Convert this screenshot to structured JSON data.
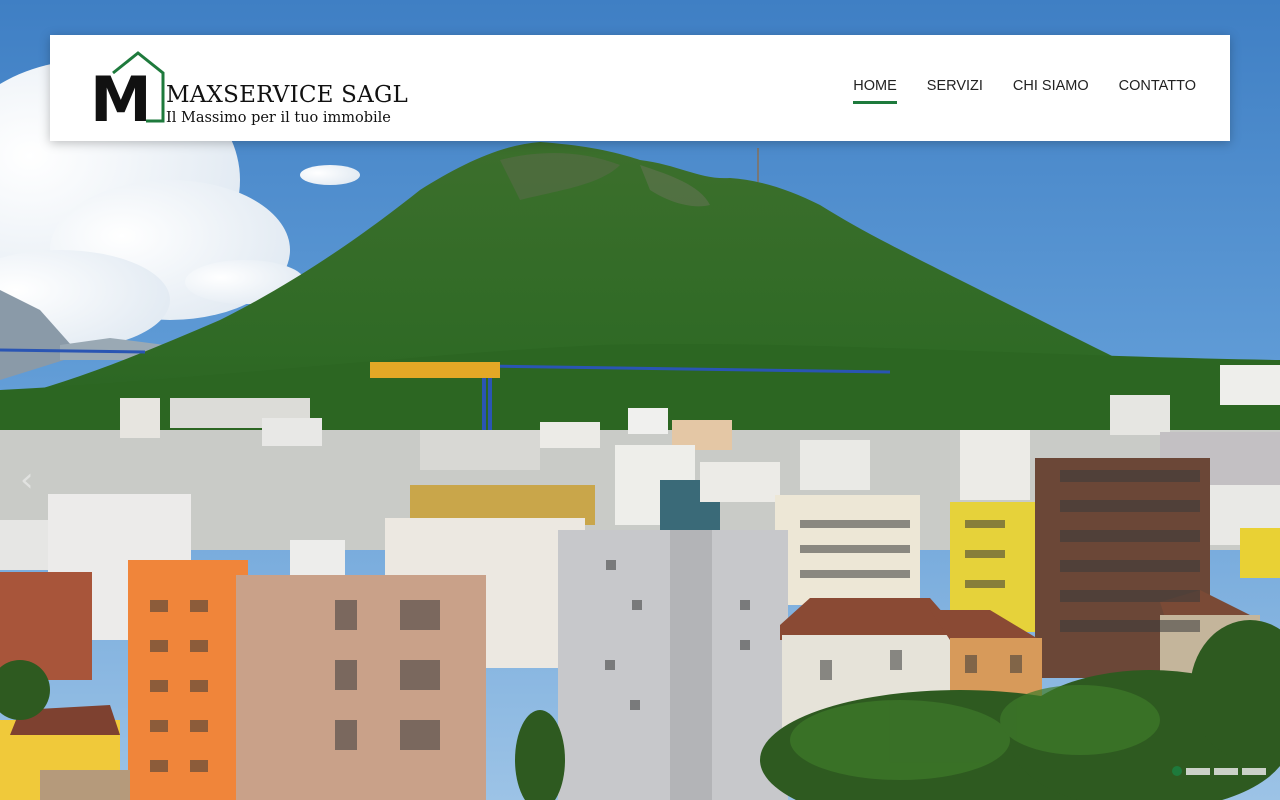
{
  "brand": {
    "logo_letter": "M",
    "name": "MAXSERVICE SAGL",
    "tagline": "Il Massimo per il tuo immobile",
    "accent_color": "#1e7a3c"
  },
  "nav": {
    "items": [
      {
        "label": "HOME",
        "active": true
      },
      {
        "label": "SERVIZI",
        "active": false
      },
      {
        "label": "CHI SIAMO",
        "active": false
      },
      {
        "label": "CONTATTO",
        "active": false
      }
    ]
  },
  "slider": {
    "prev_icon": "chevron-left-icon",
    "prev_glyph": "‹",
    "slide_count": 4,
    "active_slide": 1
  }
}
